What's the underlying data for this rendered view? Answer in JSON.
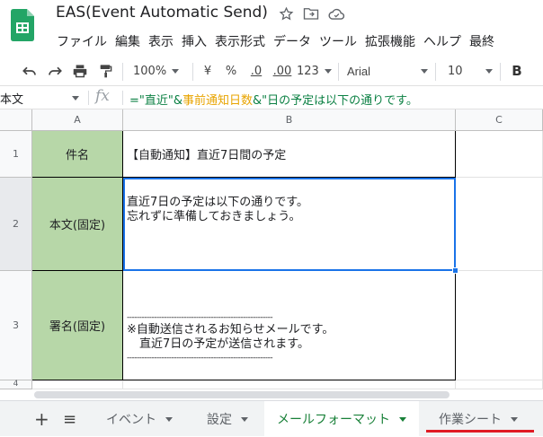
{
  "app": {
    "title": "EAS(Event Automatic Send)",
    "menus": [
      "ファイル",
      "編集",
      "表示",
      "挿入",
      "表示形式",
      "データ",
      "ツール",
      "拡張機能",
      "ヘルプ",
      "最終"
    ]
  },
  "toolbar": {
    "zoom": "100%",
    "currency": "¥",
    "percent": "%",
    "decrease_decimal": ".0",
    "increase_decimal": ".00",
    "more_formats": "123",
    "font": "Arial",
    "font_size": "10",
    "bold": "B"
  },
  "formula_bar": {
    "name_box": "本文",
    "fx": "fx",
    "formula_parts": {
      "p1": "=\"直近\"&",
      "ref": "事前通知日数",
      "p2": "&\"日の予定は以下の通りです。"
    }
  },
  "grid": {
    "columns": [
      "A",
      "B",
      "C"
    ],
    "rows": [
      "1",
      "2",
      "3",
      "4"
    ],
    "cells": {
      "a1": "件名",
      "b1": "【自動通知】直近7日間の予定",
      "a2": "本文(固定)",
      "b2_line1": "直近7日の予定は以下の通りです。",
      "b2_line2": "忘れずに準備しておきましょう。",
      "a3": "署名(固定)",
      "b3_rule1": "-----------------------------------------------------------",
      "b3_line1": "※自動送信されるお知らせメールです。",
      "b3_line2": "直近7日の予定が送信されます。",
      "b3_rule2": "-----------------------------------------------------------"
    }
  },
  "sheets": {
    "add": "+",
    "list": "≡",
    "tabs": [
      "イベント",
      "設定",
      "メールフォーマット",
      "作業シート"
    ],
    "active_index": 2
  },
  "colors": {
    "label_fill": "#b7d7a8",
    "selection": "#1a73e8",
    "active_tab_text": "#188038",
    "formula_string": "#0b8043",
    "formula_ref": "#e8a400"
  }
}
